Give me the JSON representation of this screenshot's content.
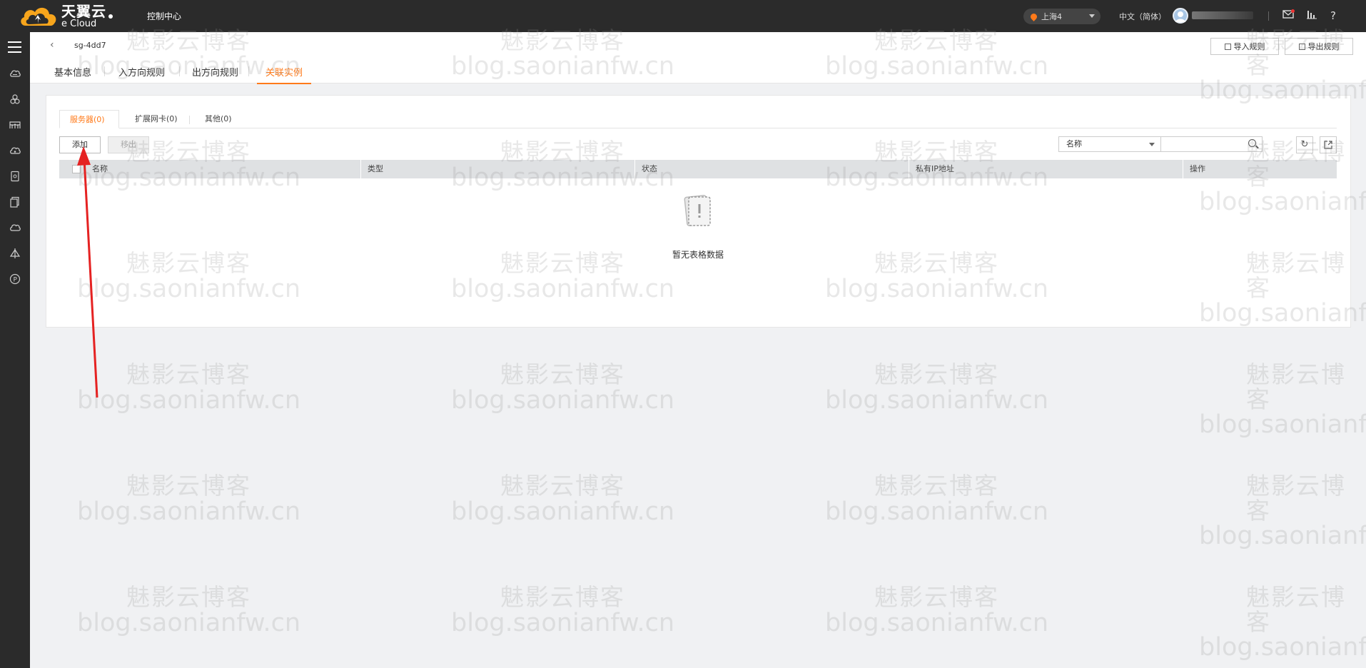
{
  "topbar": {
    "brand_cn": "天翼云",
    "brand_en": "e Cloud",
    "console_label": "控制中心",
    "region": "上海4",
    "language": "中文（简体）"
  },
  "header": {
    "resource_name": "sg-4dd7",
    "import_label": "导入规则",
    "export_label": "导出规则",
    "tabs": [
      "基本信息",
      "入方向规则",
      "出方向规则",
      "关联实例"
    ],
    "active_tab": "关联实例"
  },
  "panel": {
    "subtabs": [
      "服务器(0)",
      "扩展网卡(0)",
      "其他(0)"
    ],
    "add_label": "添加",
    "remove_label": "移出",
    "filter_option": "名称",
    "search_placeholder": "",
    "columns": [
      "名称",
      "类型",
      "状态",
      "私有IP地址",
      "操作"
    ],
    "empty_text": "暂无表格数据"
  },
  "watermark": {
    "line1": "魅影云博客",
    "line2": "blog.saonianfw.cn"
  },
  "colors": {
    "accent": "#ff7a1a",
    "topbar": "#2b2b2b",
    "annotation_arrow": "#e52222"
  },
  "icons": {
    "sidebar": [
      "menu-icon",
      "cloud-server-icon",
      "cluster-icon",
      "bridge-icon",
      "cloud-disk-icon",
      "document-icon",
      "copy-icon",
      "cloud-icon",
      "network-icon",
      "coupon-icon"
    ],
    "topbar": [
      "location-pin-icon",
      "mail-icon",
      "chart-icon",
      "help-icon"
    ],
    "toolbar": [
      "search-icon",
      "refresh-icon",
      "export-icon"
    ]
  }
}
